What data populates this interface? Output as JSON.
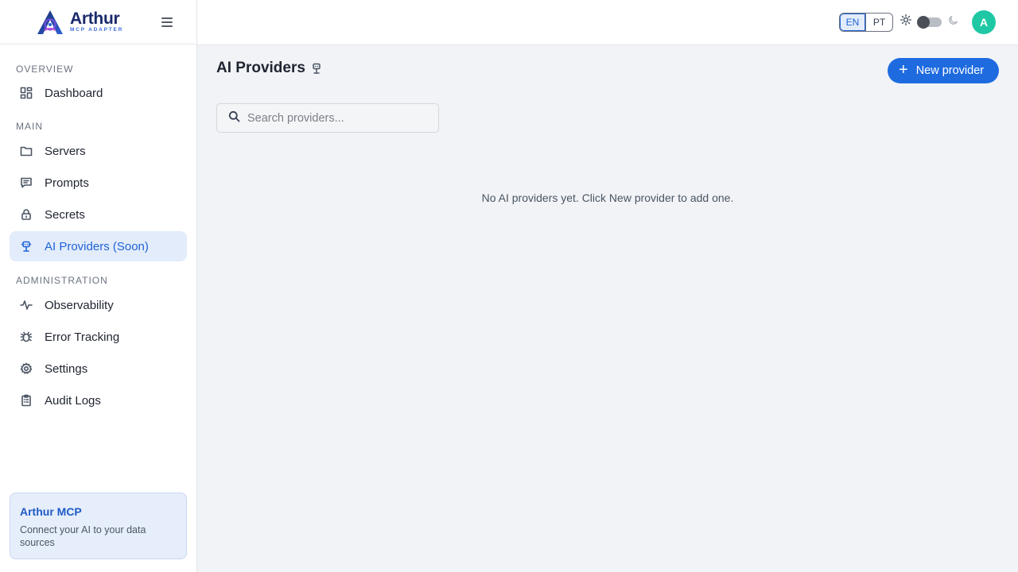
{
  "brand": {
    "name": "Arthur",
    "subtitle": "MCP ADAPTER"
  },
  "sidebar": {
    "sections": [
      {
        "label": "OVERVIEW"
      },
      {
        "label": "MAIN"
      },
      {
        "label": "ADMINISTRATION"
      }
    ],
    "items": [
      {
        "label": "Dashboard",
        "icon": "dashboard-icon"
      },
      {
        "label": "Servers",
        "icon": "folder-icon"
      },
      {
        "label": "Prompts",
        "icon": "message-icon"
      },
      {
        "label": "Secrets",
        "icon": "lock-icon"
      },
      {
        "label": "AI Providers (Soon)",
        "icon": "bot-icon",
        "active": true
      },
      {
        "label": "Observability",
        "icon": "activity-icon"
      },
      {
        "label": "Error Tracking",
        "icon": "bug-icon"
      },
      {
        "label": "Settings",
        "icon": "gear-icon"
      },
      {
        "label": "Audit Logs",
        "icon": "clipboard-icon"
      }
    ],
    "promo": {
      "title": "Arthur MCP",
      "description": "Connect your AI to your data sources"
    }
  },
  "header": {
    "languages": [
      "EN",
      "PT"
    ],
    "active_language": "EN",
    "avatar_initial": "A"
  },
  "main": {
    "title": "AI Providers",
    "new_button": "New provider",
    "search_placeholder": "Search providers...",
    "empty_message": "No AI providers yet. Click New provider to add one."
  },
  "colors": {
    "accent": "#1e6be0",
    "active_bg": "#e3ecfb",
    "avatar": "#1fc8a4"
  }
}
